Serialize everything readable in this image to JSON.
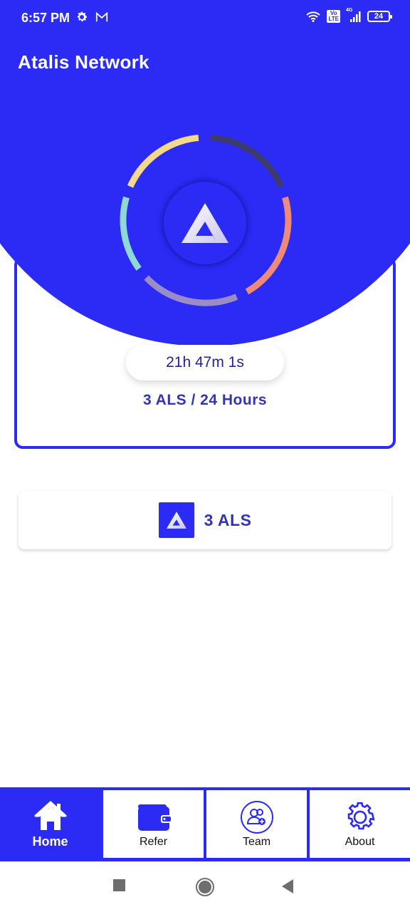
{
  "status_bar": {
    "time": "6:57 PM",
    "left_icons": [
      "gear-icon",
      "gmail-icon"
    ],
    "right_icons": [
      "wifi-icon",
      "volte-icon",
      "signal-icon",
      "battery-icon"
    ],
    "volte_label": "Vo LTE",
    "network_label": "4G",
    "battery_level": "24"
  },
  "header": {
    "title": "Atalis Network"
  },
  "colors": {
    "brand": "#2b2bf5",
    "text_accent": "#3434b8",
    "ring_segments": [
      "#f5d98a",
      "#3d3b6e",
      "#f08a78",
      "#9b8cc8",
      "#8ed8d8"
    ]
  },
  "mining": {
    "logo_icon": "atalis-logo-icon",
    "timer": "21h 47m 1s",
    "rate": "3 ALS / 24 Hours"
  },
  "balance": {
    "icon": "atalis-logo-icon",
    "amount": "3 ALS"
  },
  "bottom_nav": {
    "items": [
      {
        "label": "Home",
        "icon": "home-icon",
        "active": true
      },
      {
        "label": "Refer",
        "icon": "wallet-icon",
        "active": false
      },
      {
        "label": "Team",
        "icon": "team-add-icon",
        "active": false
      },
      {
        "label": "About",
        "icon": "gear-icon",
        "active": false
      }
    ]
  },
  "system_nav": {
    "buttons": [
      "recents-button",
      "home-button",
      "back-button"
    ]
  }
}
